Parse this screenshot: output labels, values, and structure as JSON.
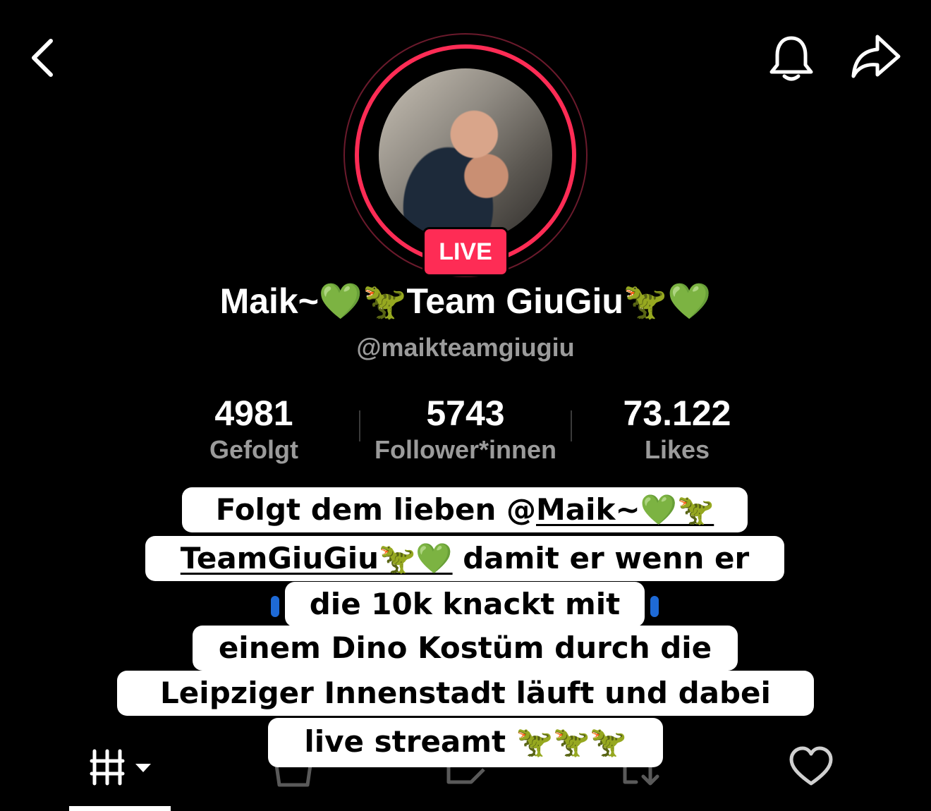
{
  "header": {
    "back_icon": "chevron-left-icon",
    "bell_icon": "bell-icon",
    "share_icon": "share-arrow-icon"
  },
  "profile": {
    "live_badge": "LIVE",
    "display_name": "Maik~💚🦖Team GiuGiu🦖💚",
    "username": "@maikteamgiugiu",
    "accent_color": "#fe2c55"
  },
  "stats": [
    {
      "value": "4981",
      "label": "Gefolgt"
    },
    {
      "value": "5743",
      "label": "Follower*innen"
    },
    {
      "value": "73.122",
      "label": "Likes"
    }
  ],
  "caption": {
    "line1_a": "Folgt dem lieben @",
    "line1_b": "Maik~💚🦖",
    "line2_a": "TeamGiuGiu🦖💚",
    "line2_b": " damit er wenn er",
    "line3": "die 10k knackt mit",
    "line4": "einem Dino Kostüm durch die",
    "line5": "Leipziger Innenstadt läuft und dabei",
    "line6": "live streamt 🦖🦖🦖"
  },
  "tabs": [
    {
      "icon": "grid-icon",
      "selected": true
    },
    {
      "icon": "shop-bag-icon",
      "selected": false
    },
    {
      "icon": "repost-icon",
      "selected": false
    },
    {
      "icon": "saved-icon",
      "selected": false
    },
    {
      "icon": "heart-icon",
      "selected": false
    }
  ]
}
